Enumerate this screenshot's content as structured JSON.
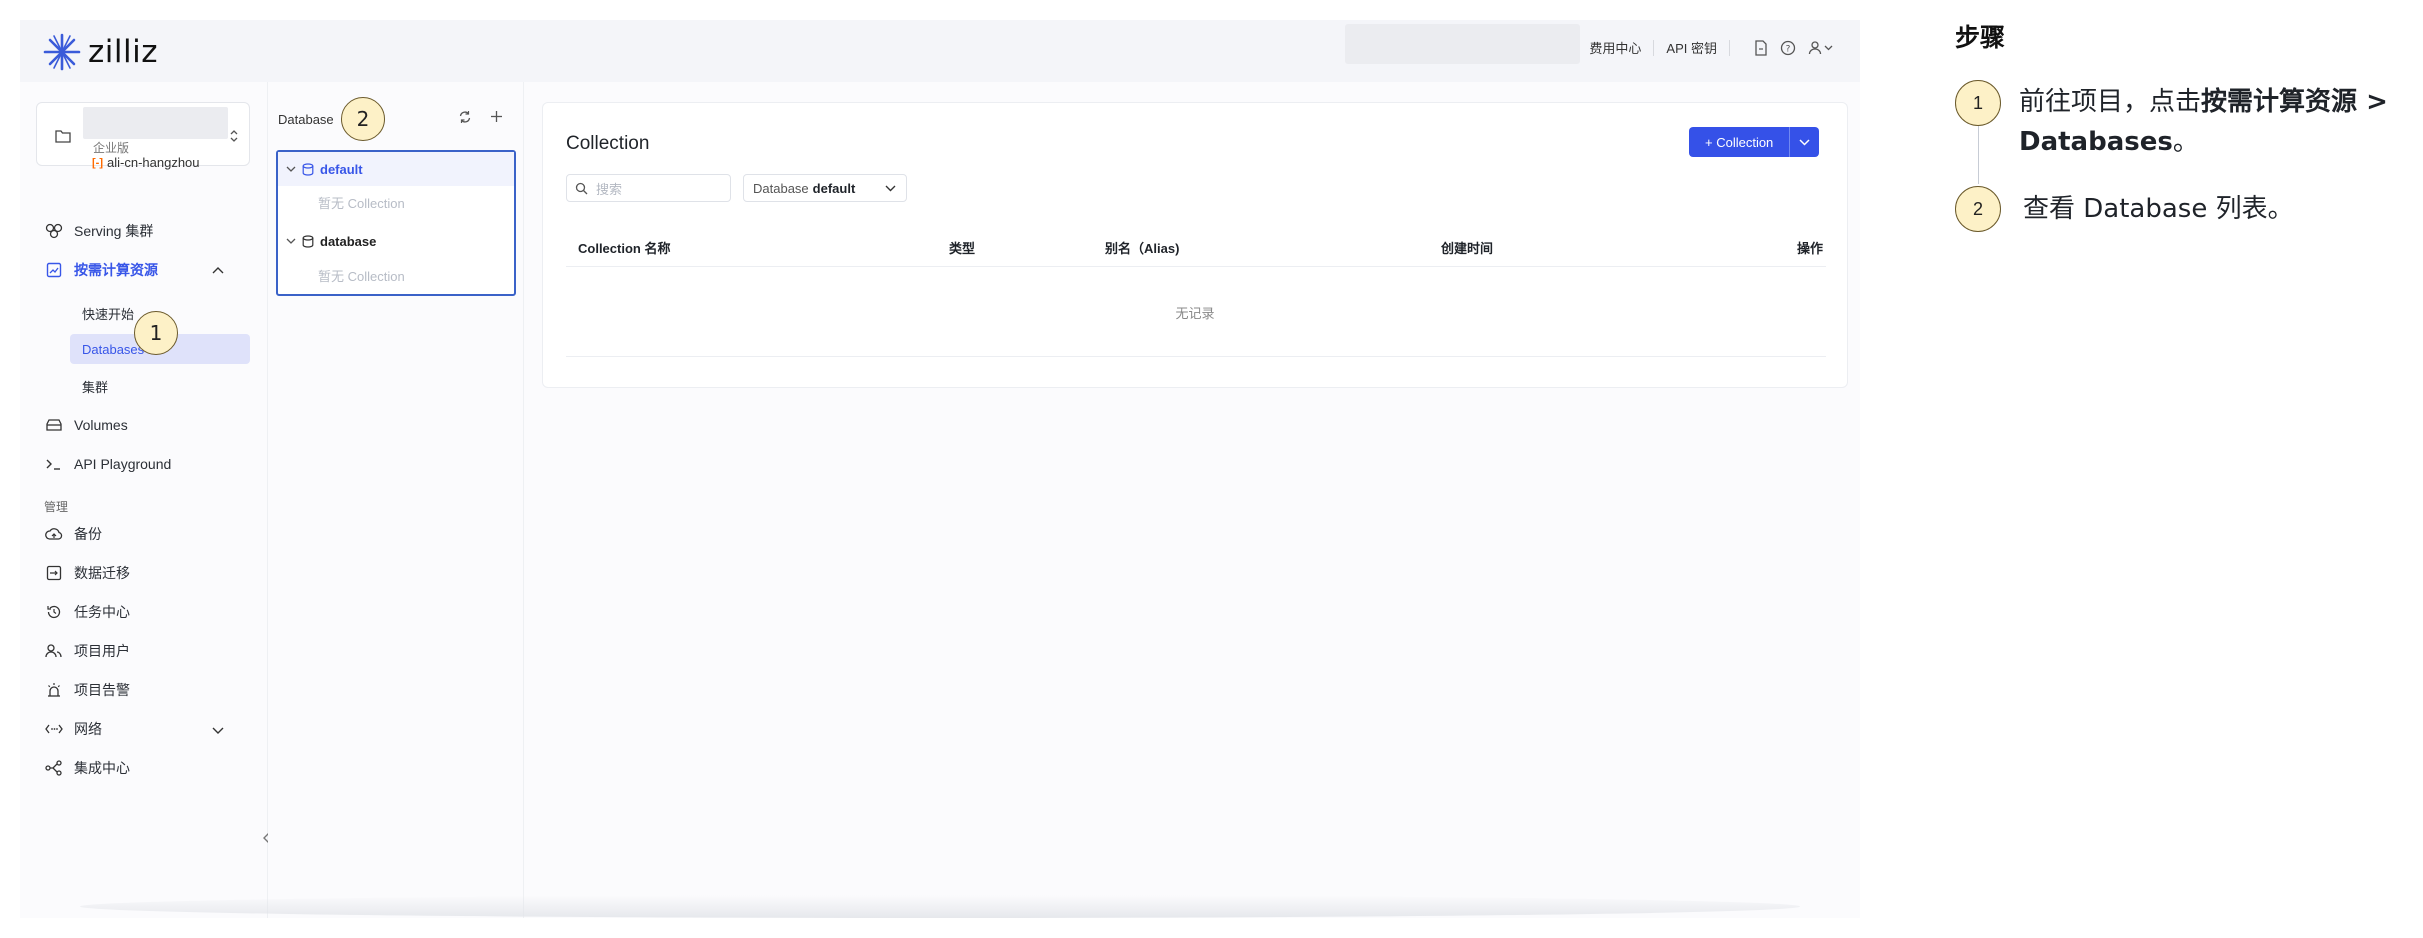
{
  "topbar": {
    "brand": "zilliz",
    "nav": [
      "费用中心",
      "API 密钥"
    ]
  },
  "sidebar": {
    "project": {
      "edition": "企业版",
      "region": "ali-cn-hangzhou",
      "cloud_mark": "[-]"
    },
    "items": [
      {
        "label": "Serving 集群",
        "icon": "serving-icon"
      },
      {
        "label": "按需计算资源",
        "icon": "compute-icon",
        "active": true
      },
      {
        "label": "快速开始"
      },
      {
        "label": "Databases"
      },
      {
        "label": "集群"
      },
      {
        "label": "Volumes",
        "icon": "volume-icon"
      },
      {
        "label": "API Playground",
        "icon": "terminal-icon"
      }
    ],
    "section_label": "管理",
    "manage_items": [
      {
        "label": "备份",
        "icon": "backup-icon"
      },
      {
        "label": "数据迁移",
        "icon": "migration-icon"
      },
      {
        "label": "任务中心",
        "icon": "task-icon"
      },
      {
        "label": "项目用户",
        "icon": "users-icon"
      },
      {
        "label": "项目告警",
        "icon": "alarm-icon"
      },
      {
        "label": "网络",
        "icon": "network-icon"
      },
      {
        "label": "集成中心",
        "icon": "integration-icon"
      }
    ]
  },
  "db_panel": {
    "title": "Database",
    "databases": [
      {
        "name": "default",
        "empty": "暂无 Collection"
      },
      {
        "name": "database",
        "empty": "暂无 Collection"
      }
    ]
  },
  "main": {
    "heading": "Collection",
    "add_button": "+ Collection",
    "search_placeholder": "搜索",
    "db_select_label": "Database",
    "db_select_value": "default",
    "columns": [
      "Collection 名称",
      "类型",
      "别名（Alias)",
      "创建时间",
      "操作"
    ],
    "empty": "无记录"
  },
  "markers": [
    "1",
    "2"
  ],
  "steps": {
    "heading": "步骤",
    "items": [
      {
        "num": "1",
        "prefix": "前往项目，点击",
        "bold": "按需计算资源 > Databases",
        "suffix": "。"
      },
      {
        "num": "2",
        "text": "查看 Database 列表。"
      }
    ]
  },
  "colors": {
    "accent": "#3551e8",
    "marker_fill": "#fdf1c7",
    "tree_border": "#3a62c8"
  }
}
